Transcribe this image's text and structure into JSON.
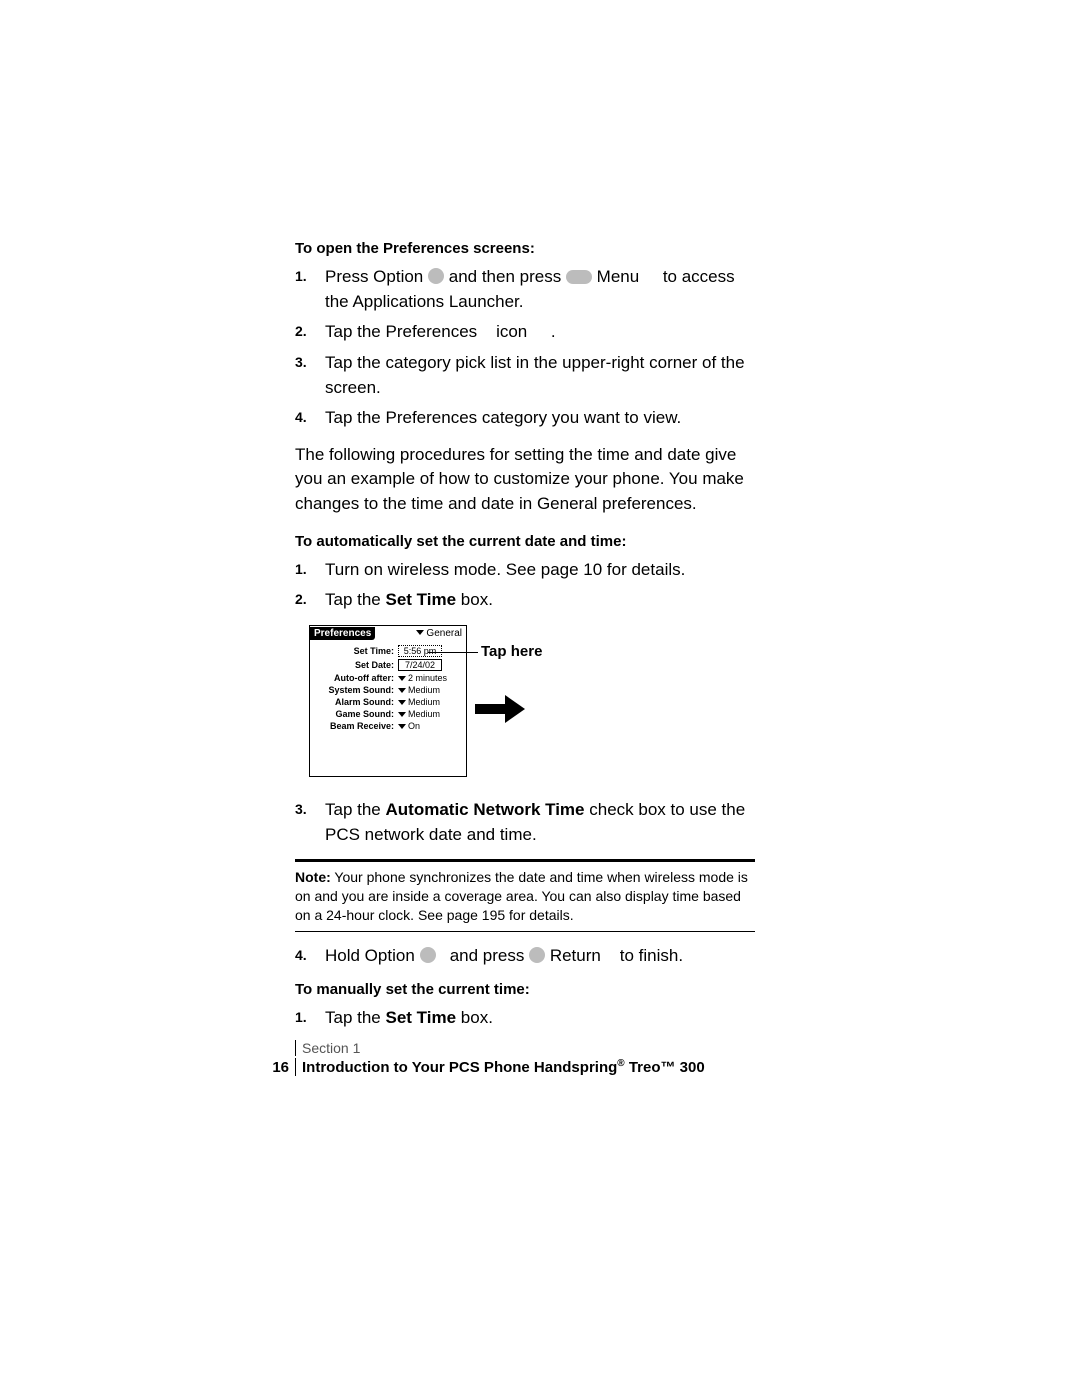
{
  "headings": {
    "open_prefs": "To open the Preferences screens:",
    "auto_set": "To automatically set the current date and time:",
    "manual_set": "To manually set the current time:"
  },
  "steps_open": {
    "s1a": "Press Option",
    "s1b": "and then press",
    "s1c": "Menu",
    "s1d": "to access the",
    "s1e": "Applications Launcher.",
    "s2a": "Tap the Preferences",
    "s2b": "icon",
    "s2c": ".",
    "s3": "Tap the category pick list in the upper-right corner of the screen.",
    "s4": "Tap the Preferences category you want to view."
  },
  "para1": "The following procedures for setting the time and date give you an example of how to customize your phone. You make changes to the time and date in General preferences.",
  "steps_auto": {
    "s1": "Turn on wireless mode. See page 10 for details.",
    "s2a": "Tap the",
    "s2b": "Set Time",
    "s2c": " box.",
    "s3a": "Tap the",
    "s3b": "Automatic Network Time",
    "s3c": " check box to use the PCS network date and time.",
    "s4a": "Hold Option",
    "s4b": "and press",
    "s4c": "Return",
    "s4d": "to finish."
  },
  "steps_manual": {
    "s1a": "Tap the",
    "s1b": "Set Time",
    "s1c": " box."
  },
  "note": {
    "label": "Note:",
    "text": " Your phone synchronizes the date and time when wireless mode is on and you are inside a coverage area. You can also display time based on a 24-hour clock. See page 195 for details."
  },
  "prefs_screen": {
    "title": "Preferences",
    "category": "General",
    "rows": {
      "set_time_label": "Set Time:",
      "set_time_val": "5:56 pm",
      "set_date_label": "Set Date:",
      "set_date_val": "7/24/02",
      "auto_off_label": "Auto-off after:",
      "auto_off_val": "2 minutes",
      "system_sound_label": "System Sound:",
      "system_sound_val": "Medium",
      "alarm_sound_label": "Alarm Sound:",
      "alarm_sound_val": "Medium",
      "game_sound_label": "Game Sound:",
      "game_sound_val": "Medium",
      "beam_label": "Beam Receive:",
      "beam_val": "On"
    },
    "callout": "Tap here"
  },
  "footer": {
    "section": "Section 1",
    "page": "16",
    "title_a": "Introduction to Your PCS Phone Handspring",
    "title_b": " Treo™ 300"
  }
}
